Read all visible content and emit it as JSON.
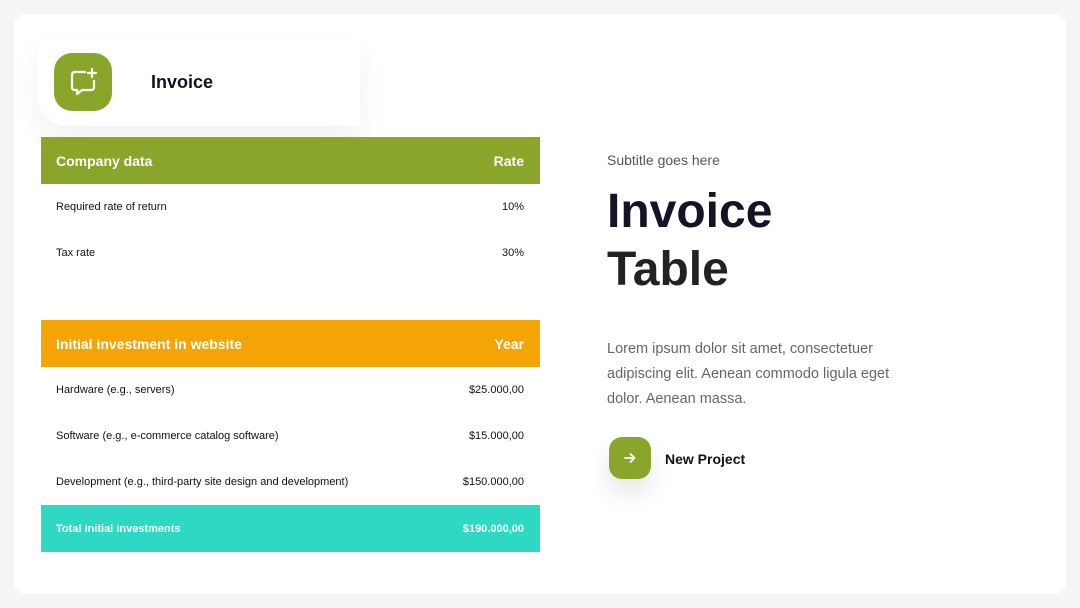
{
  "header": {
    "title": "Invoice",
    "icon": "chat-add-icon"
  },
  "company_table": {
    "header": {
      "label": "Company data",
      "value": "Rate"
    },
    "rows": [
      {
        "label": "Required rate of return",
        "value": "10%"
      },
      {
        "label": "Tax rate",
        "value": "30%"
      }
    ]
  },
  "investment_table": {
    "header": {
      "label": "Initial investment in website",
      "value": "Year"
    },
    "rows": [
      {
        "label": "Hardware (e.g., servers)",
        "value": "$25.000,00"
      },
      {
        "label": "Software (e.g., e-commerce catalog software)",
        "value": "$15.000,00"
      },
      {
        "label": "Development (e.g., third-party site design and development)",
        "value": "$150.000,00"
      }
    ],
    "total": {
      "label": "Total initial investments",
      "value": "$190.000,00"
    }
  },
  "hero": {
    "subtitle": "Subtitle goes here",
    "title_line1": "Invoice",
    "title_line2": "Table",
    "body": "Lorem ipsum dolor sit amet, consectetuer adipiscing elit. Aenean commodo ligula eget dolor. Aenean massa.",
    "cta_label": "New Project",
    "cta_icon": "arrow-right-icon"
  },
  "colors": {
    "green": "#8aa62a",
    "orange": "#f4a404",
    "teal": "#2ed8c3"
  }
}
